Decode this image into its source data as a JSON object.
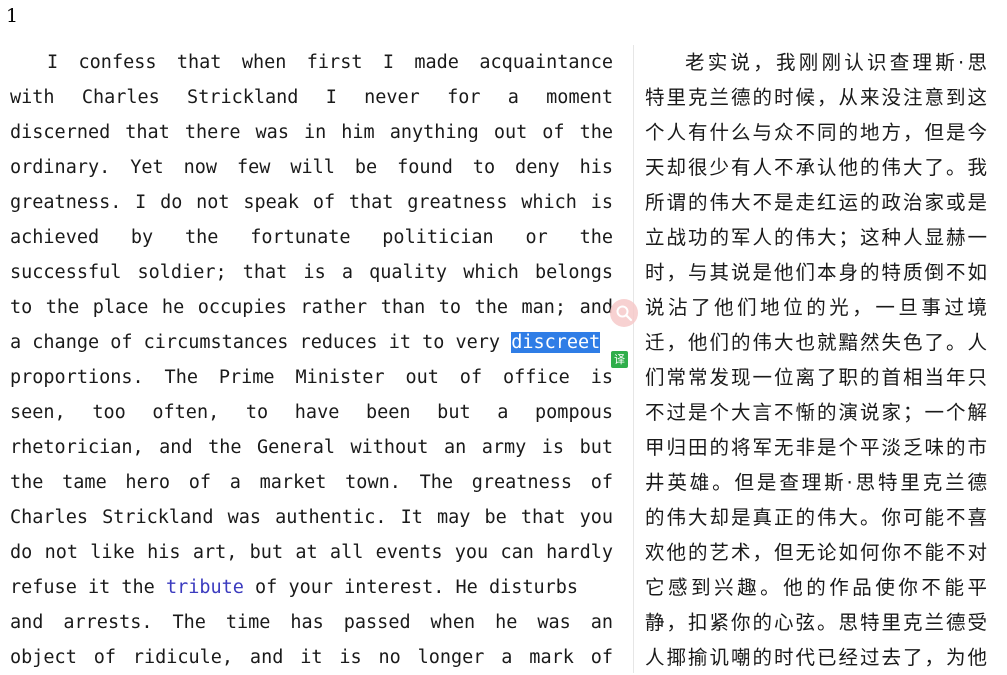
{
  "page_number": "1",
  "english": {
    "lines": [
      "I confess that when first I made acquaintance",
      "with Charles Strickland I never for a moment",
      "discerned that there was in him anything out of the",
      "ordinary. Yet now few will be found to deny his",
      "greatness. I do not speak of that greatness which is",
      "achieved by the fortunate politician or the",
      "successful soldier; that is a quality which belongs",
      "to the place he occupies rather than to the man; and",
      "a change of circumstances reduces it to very ",
      "proportions. The Prime Minister out of office is",
      "seen, too often, to have been but a pompous",
      "rhetorician, and the General without an army is but",
      "the tame hero of a market town. The greatness of",
      "Charles Strickland was authentic. It may be that you",
      "do not like his art, but at all events you can hardly",
      "refuse it the ",
      "and arrests. The time has passed when he was an",
      "object of ridicule, and it is no longer a mark of"
    ],
    "selected_word": "discreet",
    "linked_word": "tribute",
    "after_link": " of your interest. He disturbs"
  },
  "chinese": {
    "lines": [
      "老实说，我刚刚认识查理斯·思",
      "特里克兰德的时候，从来没注意到这",
      "个人有什么与众不同的地方，但是今",
      "天却很少有人不承认他的伟大了。我",
      "所谓的伟大不是走红运的政治家或是",
      "立战功的军人的伟大；这种人显赫一",
      "时，与其说是他们本身的特质倒不如",
      "说沾了他们地位的光，一旦事过境",
      "迁，他们的伟大也就黯然失色了。人",
      "们常常发现一位离了职的首相当年只",
      "不过是个大言不惭的演说家；一个解",
      "甲归田的将军无非是个平淡乏味的市",
      "井英雄。但是查理斯·思特里克兰德",
      "的伟大却是真正的伟大。你可能不喜",
      "欢他的艺术，但无论如何你不能不对",
      "它感到兴趣。他的作品使你不能平",
      "静，扣紧你的心弦。思特里克兰德受",
      "人揶揄讥嘲的时代已经过去了，为他"
    ]
  },
  "popup": {
    "search_icon": "search-icon",
    "translate_label": "译",
    "accent_color": "#2f7de6",
    "badge_color": "#2fae4b"
  }
}
